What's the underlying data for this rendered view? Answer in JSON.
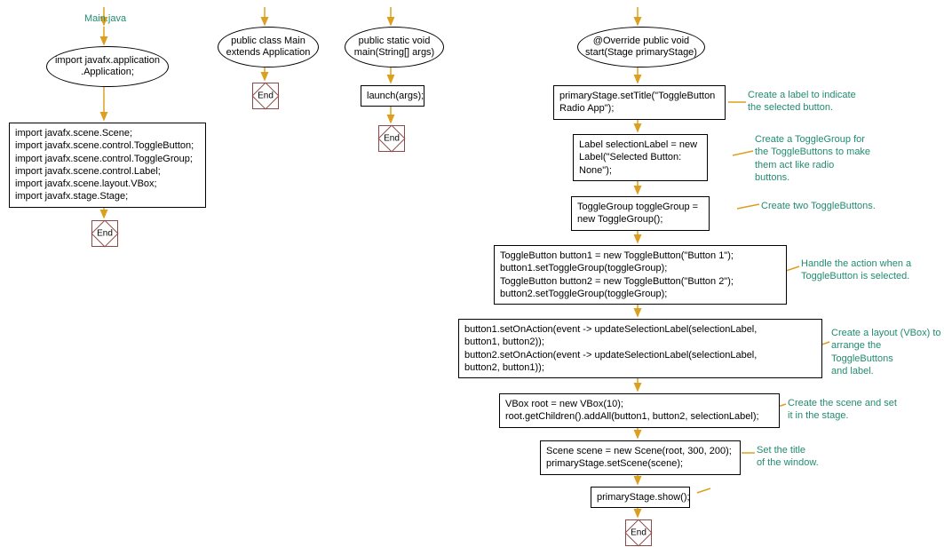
{
  "file_label": "Main.java",
  "col1": {
    "ellipse1": "import javafx.application\n.Application;",
    "box1": "import javafx.scene.Scene;\nimport javafx.scene.control.ToggleButton;\nimport javafx.scene.control.ToggleGroup;\nimport javafx.scene.control.Label;\nimport javafx.scene.layout.VBox;\nimport javafx.stage.Stage;"
  },
  "col2": {
    "ellipse1": "public class Main\nextends Application"
  },
  "col3": {
    "ellipse1": "public static void\nmain(String[] args)",
    "box1": "launch(args);"
  },
  "col4": {
    "ellipse1": "@Override public void\nstart(Stage primaryStage)",
    "box1": "primaryStage.setTitle(\"ToggleButton\nRadio App\");",
    "box2": "Label selectionLabel = new\nLabel(\"Selected Button:\nNone\");",
    "box3": "ToggleGroup toggleGroup =\nnew ToggleGroup();",
    "box4": "ToggleButton button1 = new ToggleButton(\"Button 1\");\nbutton1.setToggleGroup(toggleGroup);\nToggleButton button2 = new ToggleButton(\"Button 2\");\nbutton2.setToggleGroup(toggleGroup);",
    "box5": "button1.setOnAction(event -> updateSelectionLabel(selectionLabel,\nbutton1, button2));\nbutton2.setOnAction(event -> updateSelectionLabel(selectionLabel,\nbutton2, button1));",
    "box6": "VBox root = new VBox(10);\nroot.getChildren().addAll(button1, button2, selectionLabel);",
    "box7": "Scene scene = new Scene(root, 300, 200);\nprimaryStage.setScene(scene);",
    "box8": "primaryStage.show();"
  },
  "annotations": {
    "a1": "Create a label to indicate\nthe selected button.",
    "a2": "Create a ToggleGroup for\nthe ToggleButtons to make\nthem act like radio\nbuttons.",
    "a3": "Create two ToggleButtons.",
    "a4": "Handle the action when a\nToggleButton is selected.",
    "a5": "Create a layout (VBox) to\narrange the ToggleButtons\nand label.",
    "a6": "Create the scene and set\nit in the stage.",
    "a7": "Set the title\nof the window."
  },
  "end_label": "End"
}
